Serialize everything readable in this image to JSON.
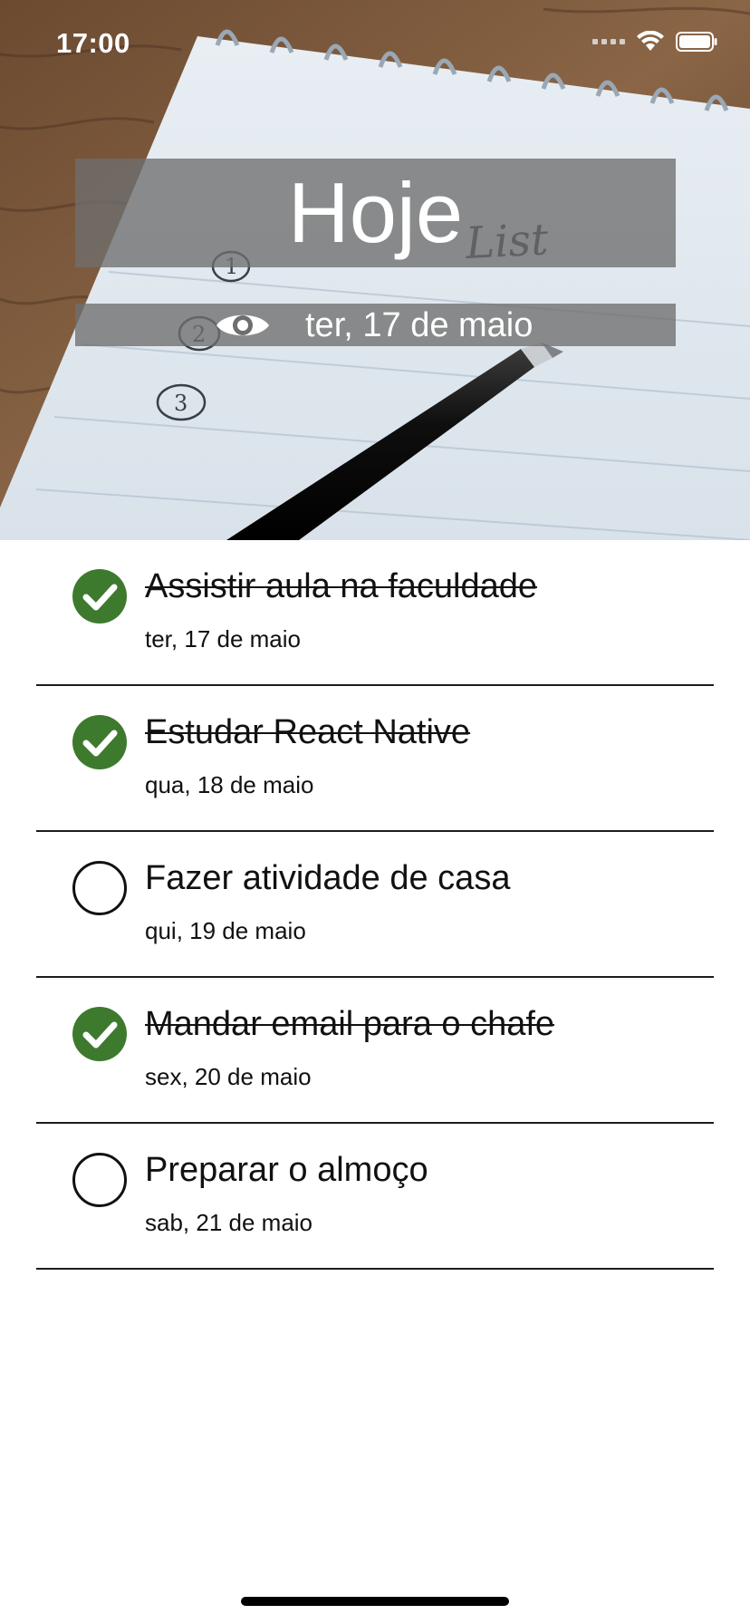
{
  "status_bar": {
    "time": "17:00",
    "icons": [
      "signal-icon",
      "wifi-icon",
      "battery-icon"
    ]
  },
  "header": {
    "title": "Hoje",
    "date": "ter, 17 de maio",
    "toggle_icon": "eye-icon",
    "notepad_text": "List"
  },
  "colors": {
    "done_check": "#3d7a2e",
    "banner": "#6e6e6e",
    "divider": "#1c1c1c"
  },
  "tasks": [
    {
      "title": "Assistir aula na faculdade",
      "date": "ter, 17 de maio",
      "done": true
    },
    {
      "title": "Estudar React Native",
      "date": "qua, 18 de maio",
      "done": true
    },
    {
      "title": "Fazer atividade de casa",
      "date": "qui, 19 de maio",
      "done": false
    },
    {
      "title": "Mandar email para o chafe",
      "date": "sex, 20 de maio",
      "done": true
    },
    {
      "title": "Preparar o almoço",
      "date": "sab, 21 de maio",
      "done": false
    }
  ]
}
